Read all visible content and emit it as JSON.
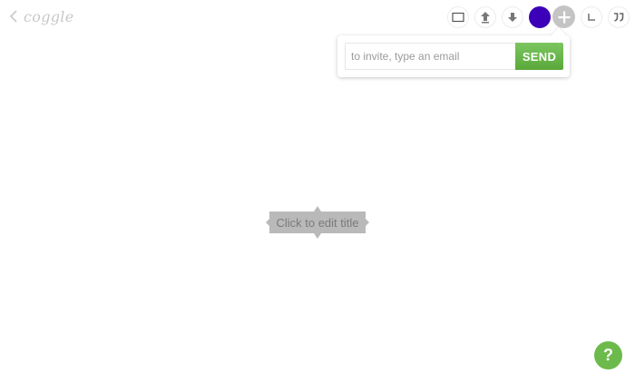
{
  "app": {
    "logo_text": "coggle"
  },
  "toolbar": {
    "buttons": [
      {
        "name": "presentation-icon"
      },
      {
        "name": "upload-icon"
      },
      {
        "name": "download-icon"
      }
    ],
    "avatar_color": "#3b00b8",
    "add_collaborator_icon": "plus-icon",
    "extra_icons": [
      "corner-icon",
      "quote-icon"
    ]
  },
  "invite": {
    "placeholder": "to invite, type an email",
    "value": "",
    "send_label": "SEND",
    "send_color": "#6dba4c"
  },
  "canvas": {
    "root_node_text": "Click to edit title",
    "node_color": "#b9b9b9"
  },
  "help": {
    "label": "?"
  }
}
